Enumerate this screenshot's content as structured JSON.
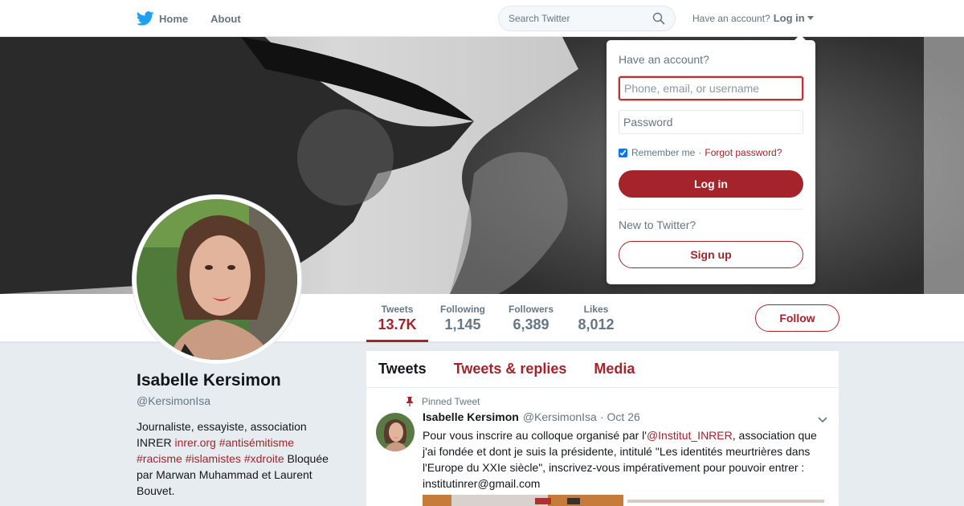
{
  "topbar": {
    "home_label": "Home",
    "about_label": "About",
    "search_placeholder": "Search Twitter",
    "have_account": "Have an account?",
    "login_label": "Log in"
  },
  "profile": {
    "name": "Isabelle Kersimon",
    "handle": "@KersimonIsa",
    "bio": {
      "text1": "Journaliste, essayiste, association INRER ",
      "link1": "inrer.org",
      "link2": "#antisémitisme",
      "link3": "#racisme",
      "link4": "#islamistes",
      "link5": "#xdroite",
      "text2": " Bloquée par Marwan Muhammad et Laurent Bouvet."
    }
  },
  "stats": [
    {
      "label": "Tweets",
      "value": "13.7K"
    },
    {
      "label": "Following",
      "value": "1,145"
    },
    {
      "label": "Followers",
      "value": "6,389"
    },
    {
      "label": "Likes",
      "value": "8,012"
    }
  ],
  "follow_label": "Follow",
  "tabs": [
    "Tweets",
    "Tweets & replies",
    "Media"
  ],
  "tweet": {
    "pinned_label": "Pinned Tweet",
    "name": "Isabelle Kersimon",
    "handle": "@KersimonIsa",
    "dot": "·",
    "time": "Oct 26",
    "body_pre": "Pour vous inscrire au colloque organisé par l'",
    "mention": "@Institut_INRER",
    "body_post": ", association que j'ai fondée et dont je suis la présidente, intitulé  \"Les identités meurtrières dans l'Europe du XXIe siècle\", inscrivez-vous impérativement pour pouvoir entrer : institutinrer@gmail.com"
  },
  "login_dropdown": {
    "title": "Have an account?",
    "username_placeholder": "Phone, email, or username",
    "password_placeholder": "Password",
    "remember": "Remember me",
    "sep": "·",
    "forgot": "Forgot password?",
    "login_button": "Log in",
    "new_label": "New to Twitter?",
    "signup_button": "Sign up"
  },
  "colors": {
    "accent": "#a5232b",
    "twitter_blue": "#1da1f2",
    "background": "#e6ecf0"
  },
  "icons": [
    "twitter-bird-icon",
    "search-icon",
    "caret-down-icon",
    "pin-icon",
    "chevron-down-icon"
  ]
}
